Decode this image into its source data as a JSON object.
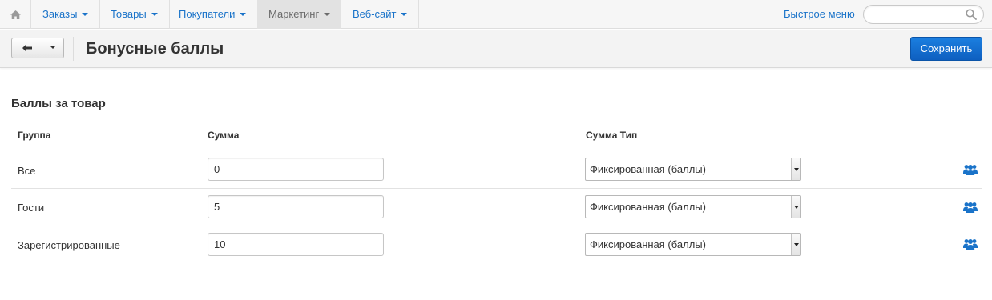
{
  "nav": {
    "items": [
      {
        "label": "Заказы"
      },
      {
        "label": "Товары"
      },
      {
        "label": "Покупатели"
      },
      {
        "label": "Маркетинг"
      },
      {
        "label": "Веб-сайт"
      }
    ],
    "active_item": "Маркетинг",
    "quick_menu": "Быстрое меню",
    "search_placeholder": ""
  },
  "header": {
    "title": "Бонусные баллы",
    "save_label": "Сохранить"
  },
  "section": {
    "title": "Баллы за товар",
    "columns": [
      "Группа",
      "Сумма",
      "Сумма Тип"
    ],
    "rows": [
      {
        "group": "Все",
        "amount": "0",
        "type": "Фиксированная (баллы)"
      },
      {
        "group": "Гости",
        "amount": "5",
        "type": "Фиксированная (баллы)"
      },
      {
        "group": "Зарегистрированные",
        "amount": "10",
        "type": "Фиксированная (баллы)"
      }
    ]
  },
  "colors": {
    "link": "#1a73c9",
    "primary_button": "#1070d6",
    "icon_blue": "#1a73c9"
  },
  "icons": {
    "home": "home-icon",
    "back": "arrow-left-icon",
    "dropdown": "caret-down-icon",
    "search": "search-icon",
    "group": "users-icon"
  }
}
